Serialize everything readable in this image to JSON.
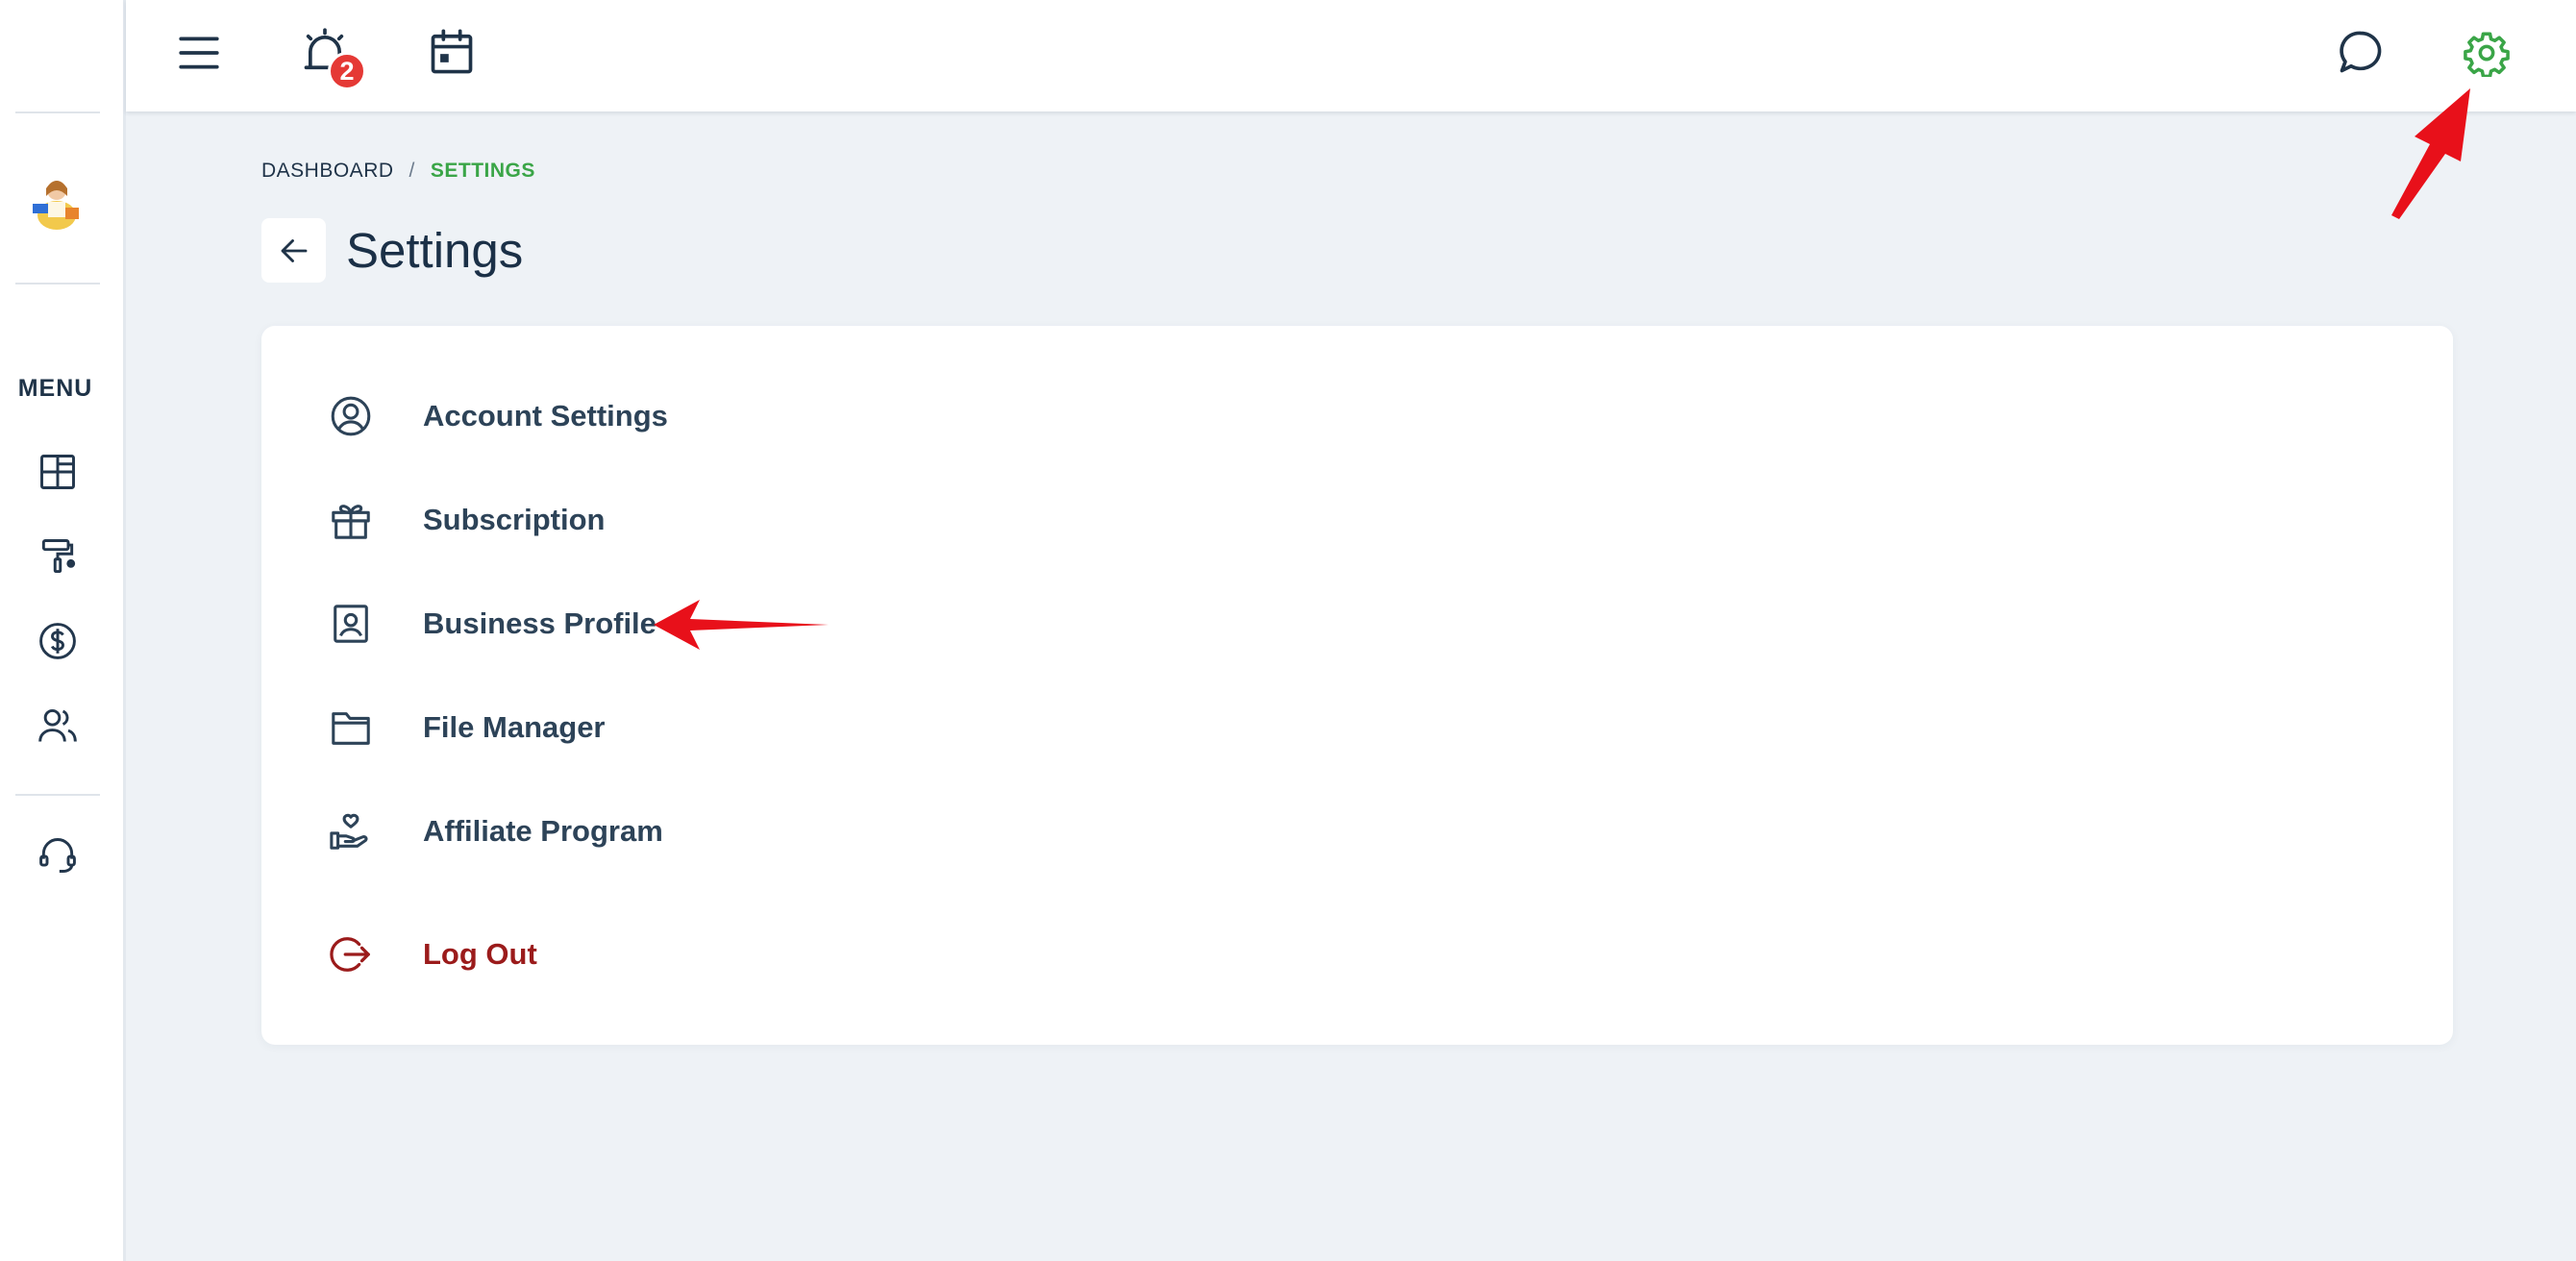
{
  "sidebar": {
    "menu_label": "MENU",
    "items": [
      {
        "icon": "dashboard-icon"
      },
      {
        "icon": "paint-roller-icon"
      },
      {
        "icon": "dollar-icon"
      },
      {
        "icon": "users-icon"
      },
      {
        "icon": "headset-icon"
      }
    ]
  },
  "topbar": {
    "notification_count": "2",
    "icons": [
      "menu-icon",
      "alarm-icon",
      "calendar-icon",
      "chat-icon",
      "gear-icon"
    ]
  },
  "breadcrumb": {
    "root": "DASHBOARD",
    "separator": "/",
    "current": "SETTINGS"
  },
  "page": {
    "title": "Settings"
  },
  "settings_menu": [
    {
      "label": "Account Settings",
      "icon": "user-circle-icon"
    },
    {
      "label": "Subscription",
      "icon": "gift-icon"
    },
    {
      "label": "Business Profile",
      "icon": "id-badge-icon"
    },
    {
      "label": "File Manager",
      "icon": "folder-icon"
    },
    {
      "label": "Affiliate Program",
      "icon": "hand-heart-icon"
    }
  ],
  "logout": {
    "label": "Log Out",
    "icon": "logout-icon"
  },
  "colors": {
    "accent_green": "#3aa547",
    "logout_red": "#9b1b1b",
    "badge_red": "#e53935",
    "annotation_red": "#e8101a"
  }
}
